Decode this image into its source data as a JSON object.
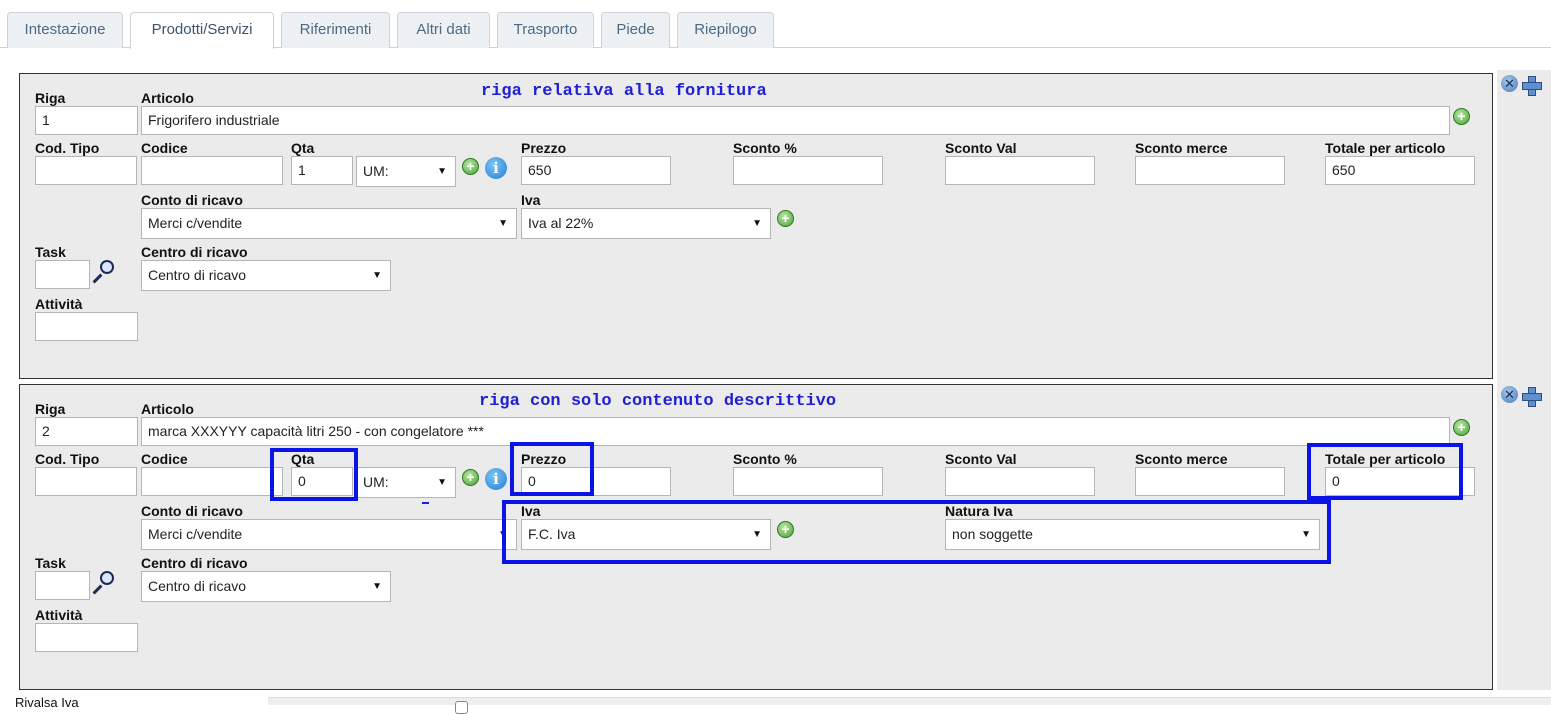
{
  "tabs": [
    {
      "label": "Intestazione"
    },
    {
      "label": "Prodotti/Servizi"
    },
    {
      "label": "Riferimenti"
    },
    {
      "label": "Altri dati"
    },
    {
      "label": "Trasporto"
    },
    {
      "label": "Piede"
    },
    {
      "label": "Riepilogo"
    }
  ],
  "active_tab": "Prodotti/Servizi",
  "labels": {
    "riga": "Riga",
    "articolo": "Articolo",
    "cod_tipo": "Cod. Tipo",
    "codice": "Codice",
    "qta": "Qta",
    "prezzo": "Prezzo",
    "sconto_pct": "Sconto %",
    "sconto_val": "Sconto Val",
    "sconto_merce": "Sconto merce",
    "totale": "Totale per articolo",
    "conto_ricavo": "Conto di ricavo",
    "iva": "Iva",
    "natura_iva": "Natura Iva",
    "task": "Task",
    "centro_ricavo": "Centro di ricavo",
    "attivita": "Attività"
  },
  "rows": [
    {
      "note": "riga relativa alla fornitura",
      "riga": "1",
      "articolo": "Frigorifero industriale",
      "cod_tipo": "",
      "codice": "",
      "qta": "1",
      "um": "UM:",
      "prezzo": "650",
      "sconto_pct": "",
      "sconto_val": "",
      "sconto_merce": "",
      "totale": "650",
      "conto_ricavo": "Merci c/vendite",
      "iva": "Iva al 22%",
      "task": "",
      "centro_ricavo": "Centro di ricavo",
      "attivita": ""
    },
    {
      "note": "riga con solo contenuto descrittivo",
      "riga": "2",
      "articolo": "marca XXXYYY  capacità litri  250 -  con congelatore  ***",
      "cod_tipo": "",
      "codice": "",
      "qta": "0",
      "um": "UM:",
      "prezzo": "0",
      "sconto_pct": "",
      "sconto_val": "",
      "sconto_merce": "",
      "totale": "0",
      "conto_ricavo": "Merci c/vendite",
      "iva": "F.C. Iva",
      "natura_iva": "non soggette",
      "task": "",
      "centro_ricavo": "Centro di ricavo",
      "attivita": ""
    }
  ],
  "footer": {
    "label": "Rivalsa Iva"
  },
  "icons": {
    "delete_row": "delete-x-icon",
    "add_row": "add-plus-icon",
    "add_green": "add-circle-icon",
    "info": "info-icon",
    "search": "magnifier-icon"
  },
  "colors": {
    "annotation": "#1f1fd6",
    "highlight": "#0a14e6",
    "panel_bg": "#ebebeb",
    "tab_text": "#4b6a86"
  }
}
